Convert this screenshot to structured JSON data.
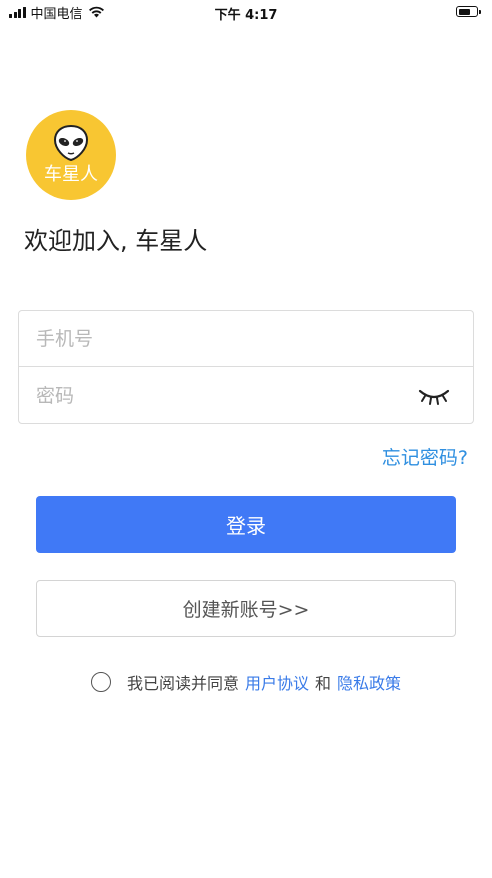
{
  "status_bar": {
    "carrier": "中国电信",
    "time": "下午 4:17"
  },
  "logo": {
    "text": "车星人",
    "color": "#f8c632",
    "icon": "alien-icon"
  },
  "welcome": "欢迎加入, 车星人",
  "form": {
    "phone_placeholder": "手机号",
    "password_placeholder": "密码",
    "toggle_icon": "eye-closed-icon"
  },
  "forgot_password": "忘记密码?",
  "login_button": "登录",
  "create_account_button": "创建新账号>>",
  "agreement": {
    "prefix": "我已阅读并同意",
    "user_agreement": "用户协议",
    "and": "和",
    "privacy_policy": "隐私政策"
  },
  "colors": {
    "accent": "#4079f6",
    "link": "#2f8fe0",
    "logo_bg": "#f8c632"
  }
}
